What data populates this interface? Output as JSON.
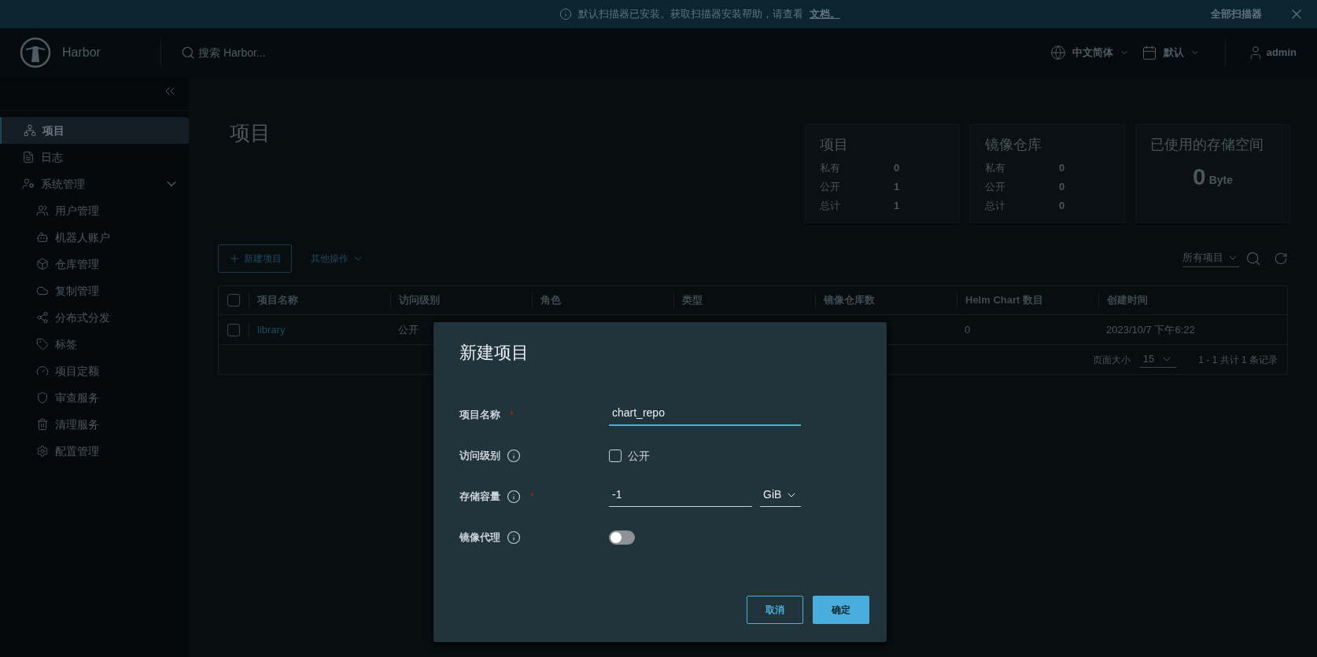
{
  "banner": {
    "message": "默认扫描器已安装。获取扫描器安装帮助，请查看",
    "link": "文档。",
    "action": "全部扫描器"
  },
  "header": {
    "brand": "Harbor",
    "search": {
      "placeholder": "搜索 Harbor..."
    },
    "language": "中文简体",
    "theme": "默认",
    "user": "admin"
  },
  "sidebar": {
    "items": [
      {
        "kind": "projects",
        "label": "项目",
        "selected": true
      },
      {
        "kind": "logs",
        "label": "日志",
        "selected": false
      },
      {
        "kind": "admin",
        "label": "系统管理",
        "selected": false,
        "expanded": true,
        "children": [
          {
            "kind": "users",
            "label": "用户管理",
            "selected": false
          },
          {
            "kind": "robot",
            "label": "机器人账户",
            "selected": false
          },
          {
            "kind": "registry",
            "label": "仓库管理",
            "selected": false
          },
          {
            "kind": "replication",
            "label": "复制管理",
            "selected": false
          },
          {
            "kind": "distribution",
            "label": "分布式分发",
            "selected": false
          },
          {
            "kind": "labels",
            "label": "标签",
            "selected": false
          },
          {
            "kind": "quota",
            "label": "项目定额",
            "selected": false
          },
          {
            "kind": "audit",
            "label": "审查服务",
            "selected": false
          },
          {
            "kind": "gc",
            "label": "清理服务",
            "selected": false
          },
          {
            "kind": "config",
            "label": "配置管理",
            "selected": false
          }
        ]
      }
    ]
  },
  "page": {
    "title": "项目"
  },
  "stats": [
    {
      "title": "项目",
      "rows": [
        {
          "label": "私有",
          "value": "0"
        },
        {
          "label": "公开",
          "value": "1"
        },
        {
          "label": "总计",
          "value": "1"
        }
      ]
    },
    {
      "title": "镜像仓库",
      "rows": [
        {
          "label": "私有",
          "value": "0"
        },
        {
          "label": "公开",
          "value": "0"
        },
        {
          "label": "总计",
          "value": "0"
        }
      ]
    }
  ],
  "storage": {
    "title": "已使用的存储空间",
    "value": "0",
    "unit": "Byte"
  },
  "toolbar": {
    "new_button": "新建项目",
    "other_actions": "其他操作",
    "filter": "所有项目"
  },
  "table": {
    "header_checked": false,
    "columns": [
      "项目名称",
      "访问级别",
      "角色",
      "类型",
      "镜像仓库数",
      "Helm Chart 数目",
      "创建时间"
    ],
    "rows": [
      {
        "checked": false,
        "name": "library",
        "access": "公开",
        "helm_charts": "0",
        "created": "2023/10/7 下午6:22"
      }
    ],
    "footer": {
      "page_size_label": "页面大小",
      "page_size": "15",
      "summary": "1 - 1 共计 1 条记录"
    }
  },
  "dialog": {
    "title": "新建项目",
    "fields": [
      {
        "kind": "text",
        "label": "项目名称",
        "info": false,
        "required_mark": "*",
        "value": "chart_repo",
        "focused": true
      },
      {
        "kind": "checkbox",
        "label": "访问级别",
        "info": true,
        "checked": false,
        "option": "公开"
      },
      {
        "kind": "quota",
        "label": "存储容量",
        "info": true,
        "required_mark": "*",
        "value": "-1",
        "unit": "GiB"
      },
      {
        "kind": "toggle",
        "label": "镜像代理",
        "info": true,
        "on": false
      }
    ],
    "buttons": [
      {
        "kind": "secondary",
        "label": "取消"
      },
      {
        "kind": "primary",
        "label": "确定"
      }
    ]
  }
}
